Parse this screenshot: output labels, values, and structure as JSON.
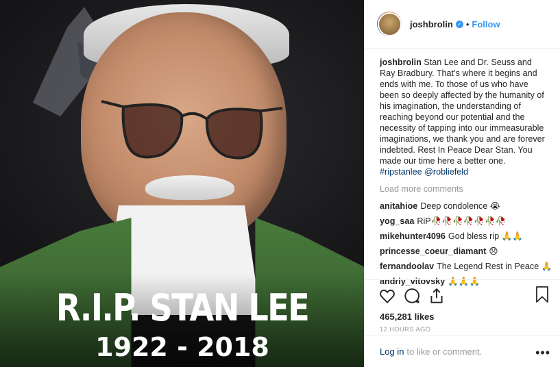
{
  "image": {
    "title": "R.I.P. STAN LEE",
    "years": "1922 - 2018"
  },
  "header": {
    "username": "joshbrolin",
    "follow_label": "Follow",
    "separator": "•"
  },
  "caption": {
    "username": "joshbrolin",
    "text": "Stan Lee and Dr. Seuss and Ray Bradbury. That’s where it begins and ends with me. To those of us who have been so deeply affected by the humanity of his imagination, the understanding of reaching beyond our potential and the necessity of tapping into our immeasurable imaginations, we thank you and are forever indebted. Rest In Peace Dear Stan. You made our time here a better one.",
    "hashtag": "#ripstanlee",
    "mention": "@robliefeld"
  },
  "load_more": "Load more comments",
  "comments": [
    {
      "user": "anitahioe",
      "text": "Deep condolence 😭"
    },
    {
      "user": "yog_saa",
      "text": "RiP🥀🥀🥀🥀🥀🥀🥀"
    },
    {
      "user": "mikehunter4096",
      "text": "God bless rip 🙏🙏"
    },
    {
      "user": "princesse_coeur_diamant",
      "text": "😞"
    },
    {
      "user": "fernandoolav",
      "text": "The Legend Rest in Peace 🙏"
    },
    {
      "user": "andriy_vitovsky",
      "text": "🙏🙏🙏"
    }
  ],
  "stats": {
    "likes": "465,281 likes",
    "time": "12 HOURS AGO"
  },
  "footer": {
    "login_link": "Log in",
    "login_text": "to like or comment.",
    "more_label": "•••"
  },
  "icons": [
    "heart-icon",
    "comment-icon",
    "share-icon",
    "bookmark-icon",
    "verified-badge-icon"
  ],
  "colors": {
    "link_blue": "#3897f0",
    "tag_blue": "#003569",
    "muted": "#999999"
  }
}
